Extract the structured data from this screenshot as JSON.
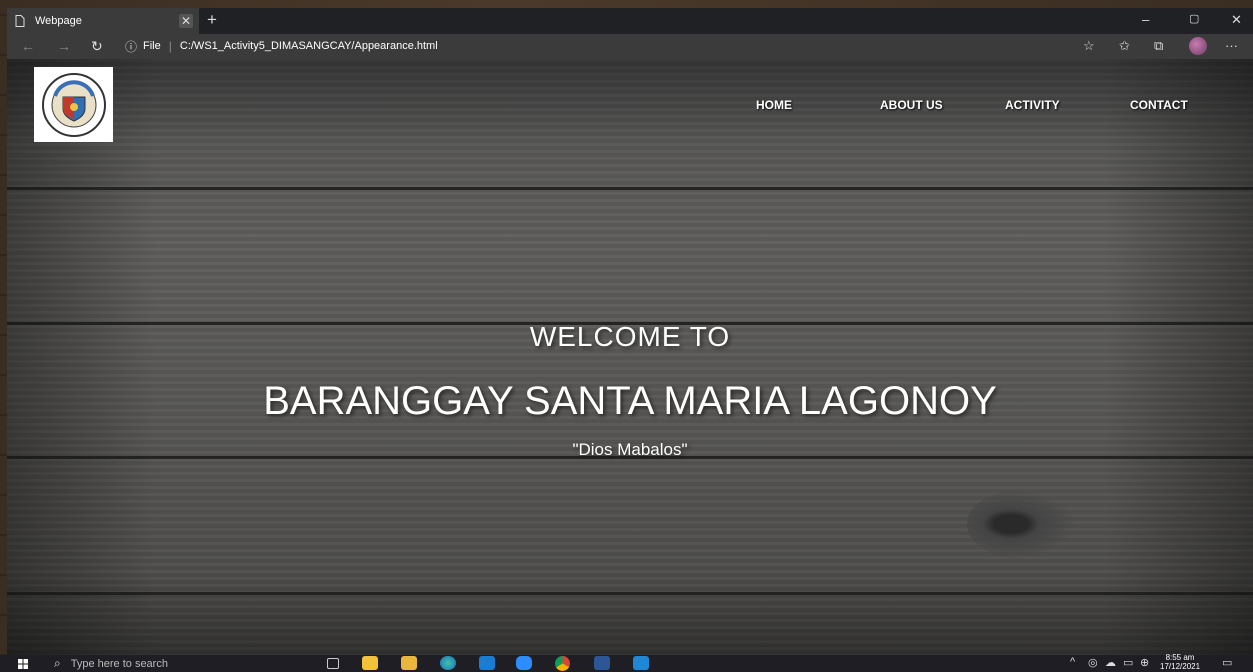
{
  "browser": {
    "tab_title": "Webpage",
    "tab_close": "✕",
    "new_tab": "+",
    "window_controls": {
      "minimize": "–",
      "restore": "▢",
      "close": "✕"
    },
    "nav": {
      "back": "←",
      "forward": "→",
      "refresh": "↻"
    },
    "address": {
      "info_icon": "ⓘ",
      "scheme_label": "File",
      "separator": "|",
      "url": "C:/WS1_Activity5_DIMASANGCAY/Appearance.html"
    },
    "toolbar_icons": [
      "favorite-add-icon",
      "favorites-icon",
      "collections-icon",
      "profile-avatar",
      "more-icon"
    ],
    "more_label": "···"
  },
  "page": {
    "nav_items": [
      "HOME",
      "ABOUT US",
      "ACTIVITY",
      "CONTACT"
    ],
    "welcome_sub": "WELCOME TO",
    "welcome_title": "BARANGGAY SANTA MARIA LAGONOY",
    "motto": "\"Dios Mabalos\"",
    "logo": {
      "top_text": "BAYAN NG LAGONOY",
      "year": "1782"
    }
  },
  "taskbar": {
    "search_placeholder": "Type here to search",
    "time": "8:55 am",
    "date": "17/12/2021",
    "pinned": [
      "task-view-icon",
      "store-icon",
      "file-explorer-icon",
      "edge-icon",
      "mail-icon",
      "zoom-icon",
      "chrome-icon",
      "word-icon",
      "vscode-icon"
    ]
  },
  "colors": {
    "browser_chrome": "#3b3b3b",
    "taskbar": "#1f1e24",
    "page_wood": "#57564f"
  }
}
